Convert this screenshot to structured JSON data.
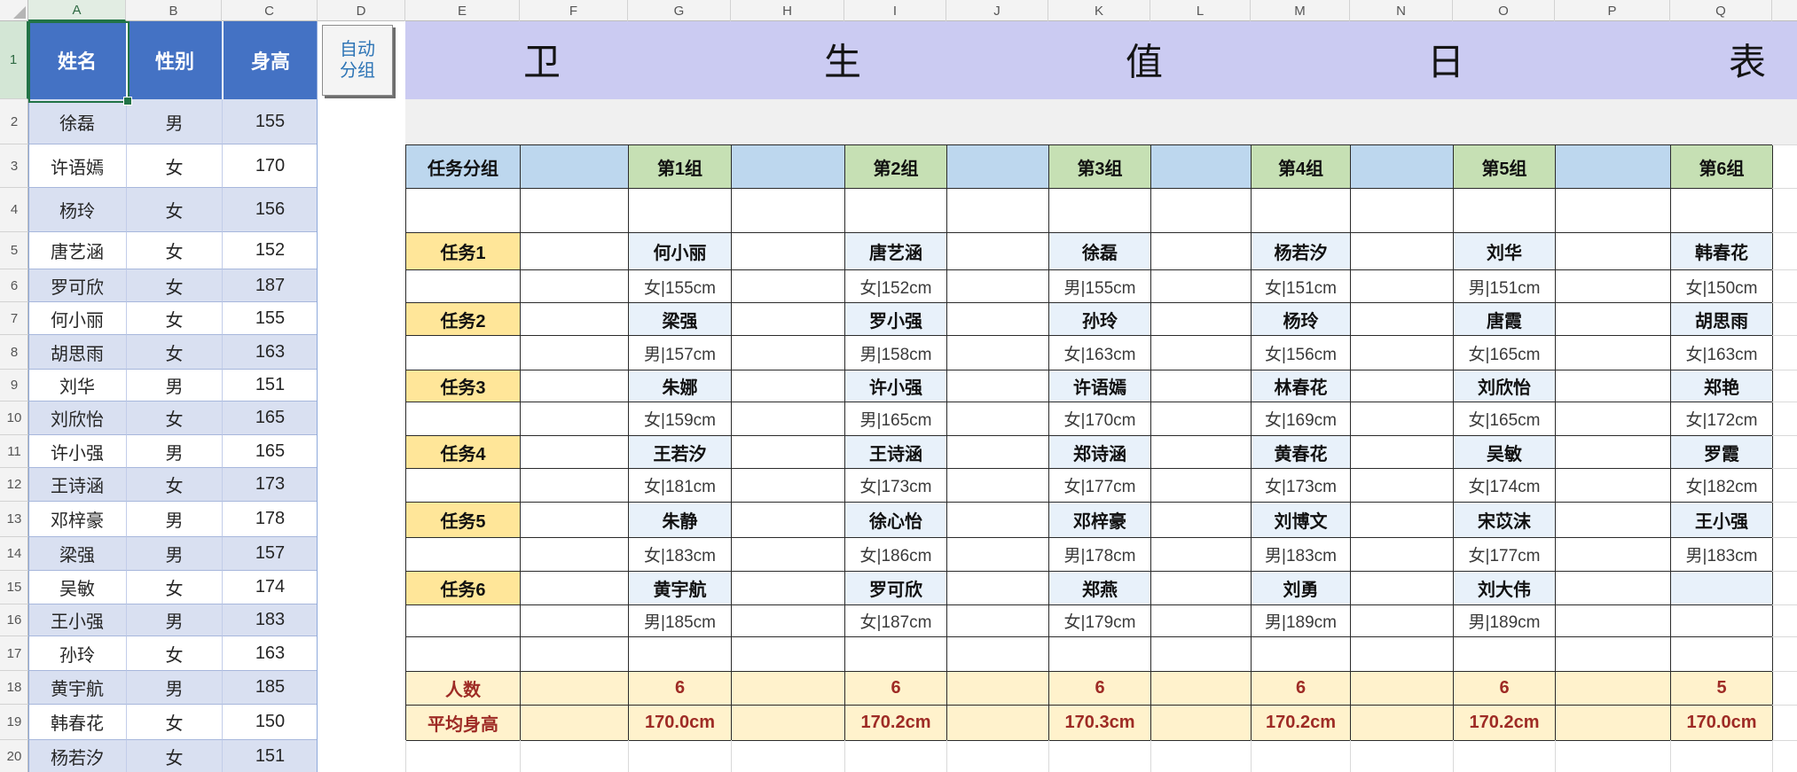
{
  "app": {
    "type": "spreadsheet-worksheet"
  },
  "colors": {
    "table_header_blue": "#4472C4",
    "band_blue": "#D9E0F1",
    "title_purple": "#CBCBF2",
    "group_header_blue": "#BDD7EE",
    "group_header_green": "#C6E0B4",
    "task_amber": "#FFE699",
    "summary_yellow": "#FFF2CC",
    "summary_text_red": "#9E2B25",
    "selection_green": "#217346",
    "button_text_blue": "#2E75B6"
  },
  "grid": {
    "column_letters": [
      "A",
      "B",
      "C",
      "D",
      "E",
      "F",
      "G",
      "H",
      "I",
      "J",
      "K",
      "L",
      "M",
      "N",
      "O",
      "P",
      "Q"
    ],
    "row_numbers": [
      "1",
      "2",
      "3",
      "4",
      "5",
      "6",
      "7",
      "8",
      "9",
      "10",
      "11",
      "12",
      "13",
      "14",
      "15",
      "16",
      "17",
      "18",
      "19",
      "20"
    ],
    "selected_cell": "A1"
  },
  "left_table": {
    "headers": [
      "姓名",
      "性别",
      "身高"
    ],
    "rows": [
      {
        "name": "徐磊",
        "gender": "男",
        "height": "155"
      },
      {
        "name": "许语嫣",
        "gender": "女",
        "height": "170"
      },
      {
        "name": "杨玲",
        "gender": "女",
        "height": "156"
      },
      {
        "name": "唐艺涵",
        "gender": "女",
        "height": "152"
      },
      {
        "name": "罗可欣",
        "gender": "女",
        "height": "187"
      },
      {
        "name": "何小丽",
        "gender": "女",
        "height": "155"
      },
      {
        "name": "胡思雨",
        "gender": "女",
        "height": "163"
      },
      {
        "name": "刘华",
        "gender": "男",
        "height": "151"
      },
      {
        "name": "刘欣怡",
        "gender": "女",
        "height": "165"
      },
      {
        "name": "许小强",
        "gender": "男",
        "height": "165"
      },
      {
        "name": "王诗涵",
        "gender": "女",
        "height": "173"
      },
      {
        "name": "邓梓豪",
        "gender": "男",
        "height": "178"
      },
      {
        "name": "梁强",
        "gender": "男",
        "height": "157"
      },
      {
        "name": "吴敏",
        "gender": "女",
        "height": "174"
      },
      {
        "name": "王小强",
        "gender": "男",
        "height": "183"
      },
      {
        "name": "孙玲",
        "gender": "女",
        "height": "163"
      },
      {
        "name": "黄宇航",
        "gender": "男",
        "height": "185"
      },
      {
        "name": "韩春花",
        "gender": "女",
        "height": "150"
      },
      {
        "name": "杨若汐",
        "gender": "女",
        "height": "151"
      }
    ]
  },
  "auto_group_button": {
    "label": "自动分组",
    "lines": [
      "自动",
      "分组"
    ]
  },
  "title": {
    "text": "卫生值日表",
    "chars": [
      "卫",
      "生",
      "值",
      "日",
      "表"
    ]
  },
  "group_table": {
    "corner_label": "任务分组",
    "group_headers": [
      "第1组",
      "第2组",
      "第3组",
      "第4组",
      "第5组",
      "第6组"
    ],
    "task_labels": [
      "任务1",
      "任务2",
      "任务3",
      "任务4",
      "任务5",
      "任务6"
    ],
    "count_label": "人数",
    "avg_label": "平均身高",
    "groups": [
      {
        "count": "6",
        "avg": "170.0cm",
        "members": [
          {
            "name": "何小丽",
            "info": "女|155cm"
          },
          {
            "name": "梁强",
            "info": "男|157cm"
          },
          {
            "name": "朱娜",
            "info": "女|159cm"
          },
          {
            "name": "王若汐",
            "info": "女|181cm"
          },
          {
            "name": "朱静",
            "info": "女|183cm"
          },
          {
            "name": "黄宇航",
            "info": "男|185cm"
          }
        ]
      },
      {
        "count": "6",
        "avg": "170.2cm",
        "members": [
          {
            "name": "唐艺涵",
            "info": "女|152cm"
          },
          {
            "name": "罗小强",
            "info": "男|158cm"
          },
          {
            "name": "许小强",
            "info": "男|165cm"
          },
          {
            "name": "王诗涵",
            "info": "女|173cm"
          },
          {
            "name": "徐心怡",
            "info": "女|186cm"
          },
          {
            "name": "罗可欣",
            "info": "女|187cm"
          }
        ]
      },
      {
        "count": "6",
        "avg": "170.3cm",
        "members": [
          {
            "name": "徐磊",
            "info": "男|155cm"
          },
          {
            "name": "孙玲",
            "info": "女|163cm"
          },
          {
            "name": "许语嫣",
            "info": "女|170cm"
          },
          {
            "name": "郑诗涵",
            "info": "女|177cm"
          },
          {
            "name": "邓梓豪",
            "info": "男|178cm"
          },
          {
            "name": "郑燕",
            "info": "女|179cm"
          }
        ]
      },
      {
        "count": "6",
        "avg": "170.2cm",
        "members": [
          {
            "name": "杨若汐",
            "info": "女|151cm"
          },
          {
            "name": "杨玲",
            "info": "女|156cm"
          },
          {
            "name": "林春花",
            "info": "女|169cm"
          },
          {
            "name": "黄春花",
            "info": "女|173cm"
          },
          {
            "name": "刘博文",
            "info": "男|183cm"
          },
          {
            "name": "刘勇",
            "info": "男|189cm"
          }
        ]
      },
      {
        "count": "6",
        "avg": "170.2cm",
        "members": [
          {
            "name": "刘华",
            "info": "男|151cm"
          },
          {
            "name": "唐霞",
            "info": "女|165cm"
          },
          {
            "name": "刘欣怡",
            "info": "女|165cm"
          },
          {
            "name": "吴敏",
            "info": "女|174cm"
          },
          {
            "name": "宋苡沫",
            "info": "女|177cm"
          },
          {
            "name": "刘大伟",
            "info": "男|189cm"
          }
        ]
      },
      {
        "count": "5",
        "avg": "170.0cm",
        "members": [
          {
            "name": "韩春花",
            "info": "女|150cm"
          },
          {
            "name": "胡思雨",
            "info": "女|163cm"
          },
          {
            "name": "郑艳",
            "info": "女|172cm"
          },
          {
            "name": "罗霞",
            "info": "女|182cm"
          },
          {
            "name": "王小强",
            "info": "男|183cm"
          },
          {
            "name": "",
            "info": ""
          }
        ]
      }
    ]
  }
}
